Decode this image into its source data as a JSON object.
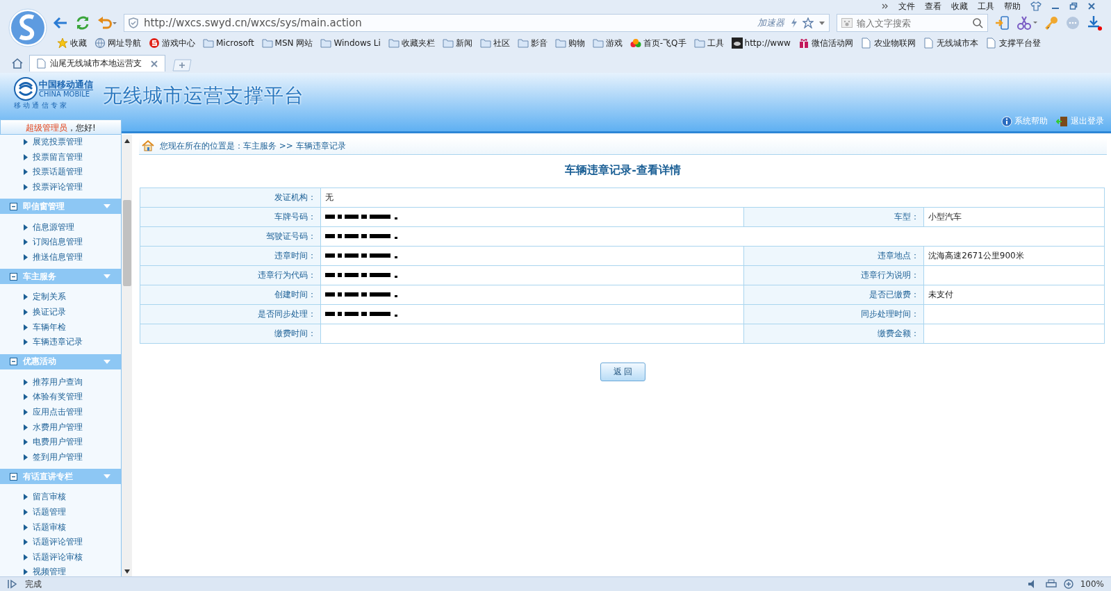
{
  "browser": {
    "menu": [
      "文件",
      "查看",
      "收藏",
      "工具",
      "帮助"
    ],
    "address": "http://wxcs.swyd.cn/wxcs/sys/main.action",
    "accelerator": "加速器",
    "search": {
      "placeholder": "输入文字搜索"
    },
    "bookmarks": [
      {
        "kind": "star",
        "label": "收藏"
      },
      {
        "kind": "globe",
        "label": "网址导航"
      },
      {
        "kind": "game",
        "label": "游戏中心"
      },
      {
        "kind": "folder",
        "label": "Microsoft"
      },
      {
        "kind": "folder",
        "label": "MSN 网站"
      },
      {
        "kind": "folder",
        "label": "Windows Li"
      },
      {
        "kind": "folder",
        "label": "收藏夹栏"
      },
      {
        "kind": "folder",
        "label": "新闻"
      },
      {
        "kind": "folder",
        "label": "社区"
      },
      {
        "kind": "folder",
        "label": "影音"
      },
      {
        "kind": "folder",
        "label": "购物"
      },
      {
        "kind": "folder",
        "label": "游戏"
      },
      {
        "kind": "balls",
        "label": "首页-飞Q手"
      },
      {
        "kind": "folder",
        "label": "工具"
      },
      {
        "kind": "photo",
        "label": "http://www"
      },
      {
        "kind": "gift",
        "label": "微信活动网"
      },
      {
        "kind": "page",
        "label": "农业物联网"
      },
      {
        "kind": "page",
        "label": "无线城市本"
      },
      {
        "kind": "page",
        "label": "支撑平台登"
      }
    ],
    "tabs": [
      {
        "title": "汕尾无线城市本地运营支",
        "selected": true
      }
    ],
    "status": "完成",
    "zoom": "100%"
  },
  "header": {
    "logo_cn": "中国移动通信",
    "logo_en": "CHINA MOBILE",
    "logo_slogan": "移 动 通 信 专 家",
    "title": "无线城市运营支撑平台",
    "links": [
      {
        "kind": "help",
        "label": "系统帮助"
      },
      {
        "kind": "logout",
        "label": "退出登录"
      }
    ]
  },
  "sidebar": {
    "welcome_role": "超级管理员",
    "welcome_text": "，您好!",
    "groups": [
      {
        "items": [
          "展览投票管理",
          "投票留言管理",
          "投票话题管理",
          "投票评论管理"
        ]
      },
      {
        "title": "即信窗管理",
        "expanded": true,
        "items": [
          "信息源管理",
          "订阅信息管理",
          "推送信息管理"
        ]
      },
      {
        "title": "车主服务",
        "expanded": true,
        "items": [
          "定制关系",
          "换证记录",
          "车辆年检",
          "车辆违章记录"
        ]
      },
      {
        "title": "优惠活动",
        "expanded": true,
        "items": [
          "推荐用户查询",
          "体验有奖管理",
          "应用点击管理",
          "水费用户管理",
          "电费用户管理",
          "签到用户管理"
        ]
      },
      {
        "title": "有话直讲专栏",
        "expanded": true,
        "items": [
          "留言审核",
          "话题管理",
          "话题审核",
          "话题评论管理",
          "话题评论审核",
          "视频管理"
        ]
      }
    ]
  },
  "breadcrumb": "您现在所在的位置是：车主服务 >> 车辆违章记录",
  "page_title": "车辆违章记录-查看详情",
  "details": [
    [
      {
        "label": "发证机构：",
        "value": "无"
      }
    ],
    [
      {
        "label": "车牌号码：",
        "redacted": true
      },
      {
        "label": "车型：",
        "value": "小型汽车"
      }
    ],
    [
      {
        "label": "驾驶证号码：",
        "redacted": true
      }
    ],
    [
      {
        "label": "违章时间：",
        "redacted": true
      },
      {
        "label": "违章地点：",
        "value": "沈海高速2671公里900米"
      }
    ],
    [
      {
        "label": "违章行为代码：",
        "redacted": true
      },
      {
        "label": "违章行为说明："
      }
    ],
    [
      {
        "label": "创建时间：",
        "redacted": true
      },
      {
        "label": "是否已缴费：",
        "value": "未支付"
      }
    ],
    [
      {
        "label": "是否同步处理：",
        "redacted": true
      },
      {
        "label": "同步处理时间："
      }
    ],
    [
      {
        "label": "缴费时间："
      },
      {
        "label": "缴费金额："
      }
    ]
  ],
  "back_button": "返 回"
}
